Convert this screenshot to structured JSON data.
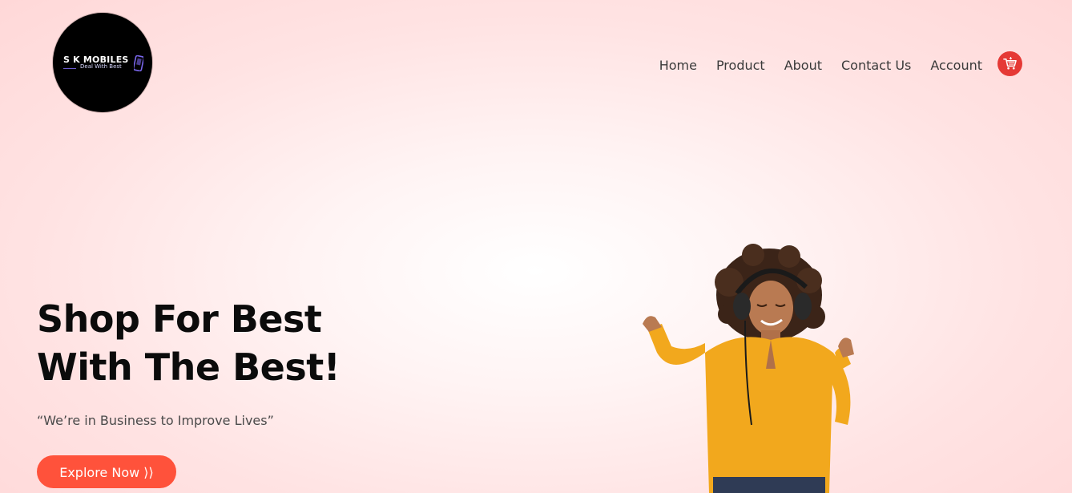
{
  "brand": {
    "name": "S K MOBILES",
    "tagline": "Deal With Best"
  },
  "nav": {
    "items": [
      {
        "label": "Home"
      },
      {
        "label": "Product"
      },
      {
        "label": "About"
      },
      {
        "label": "Contact Us"
      },
      {
        "label": "Account"
      }
    ]
  },
  "hero": {
    "title_line1": "Shop For Best",
    "title_line2": "With The Best!",
    "quote": "“We’re in Business to Improve Lives”",
    "cta_label": "Explore Now ⟩⟩"
  },
  "colors": {
    "accent": "#ff523b",
    "cart": "#e53935",
    "title": "#0b0b0b",
    "logo_bg": "#000000",
    "shirt": "#f2a81d"
  },
  "icons": {
    "cart": "shopping-cart-icon",
    "logo_phone": "mobile-phone-icon"
  }
}
